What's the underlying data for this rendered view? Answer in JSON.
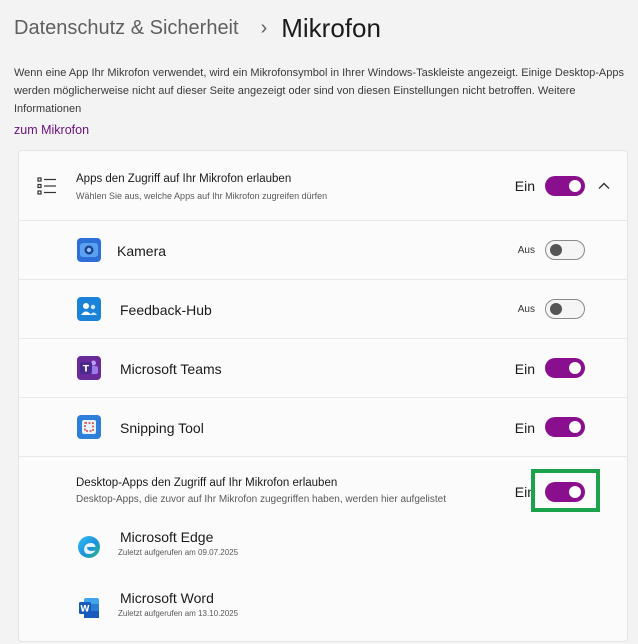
{
  "breadcrumb": {
    "parent": "Datenschutz & Sicherheit",
    "separator": "›",
    "current": "Mikrofon"
  },
  "intro": {
    "text": "Wenn eine App Ihr Mikrofon verwendet, wird ein Mikrofonsymbol in Ihrer Windows-Taskleiste angezeigt. Einige Desktop-Apps werden möglicherweise nicht auf dieser Seite angezeigt oder sind von diesen Einstellungen nicht betroffen. Weitere Informationen",
    "link": "zum Mikrofon"
  },
  "apps_access": {
    "title": "Apps den Zugriff auf Ihr Mikrofon erlauben",
    "subtitle": "Wählen Sie aus, welche Apps auf Ihr Mikrofon zugreifen dürfen",
    "state": "Ein",
    "icon": "list-icon",
    "expand_icon": "chevron-up-icon"
  },
  "apps": [
    {
      "name": "Kamera",
      "state": "Aus",
      "on": false,
      "icon": "camera-app-icon"
    },
    {
      "name": "Feedback-Hub",
      "state": "Aus",
      "on": false,
      "icon": "feedback-hub-icon"
    },
    {
      "name": "Microsoft Teams",
      "state": "Ein",
      "on": true,
      "icon": "teams-icon"
    },
    {
      "name": "Snipping Tool",
      "state": "Ein",
      "on": true,
      "icon": "snipping-tool-icon"
    }
  ],
  "desktop_access": {
    "title": "Desktop-Apps den Zugriff auf Ihr Mikrofon erlauben",
    "subtitle": "Desktop-Apps, die zuvor auf Ihr Mikrofon zugegriffen haben, werden hier aufgelistet",
    "state": "Ein"
  },
  "desktop_apps": [
    {
      "name": "Microsoft Edge",
      "last_access": "Zuletzt aufgerufen am 09.07.2025",
      "icon": "edge-icon"
    },
    {
      "name": "Microsoft Word",
      "last_access": "Zuletzt aufgerufen am 13.10.2025",
      "icon": "word-icon"
    }
  ],
  "colors": {
    "accent": "#8a0f8e",
    "highlight": "#1aa34a",
    "link": "#6b1480"
  }
}
